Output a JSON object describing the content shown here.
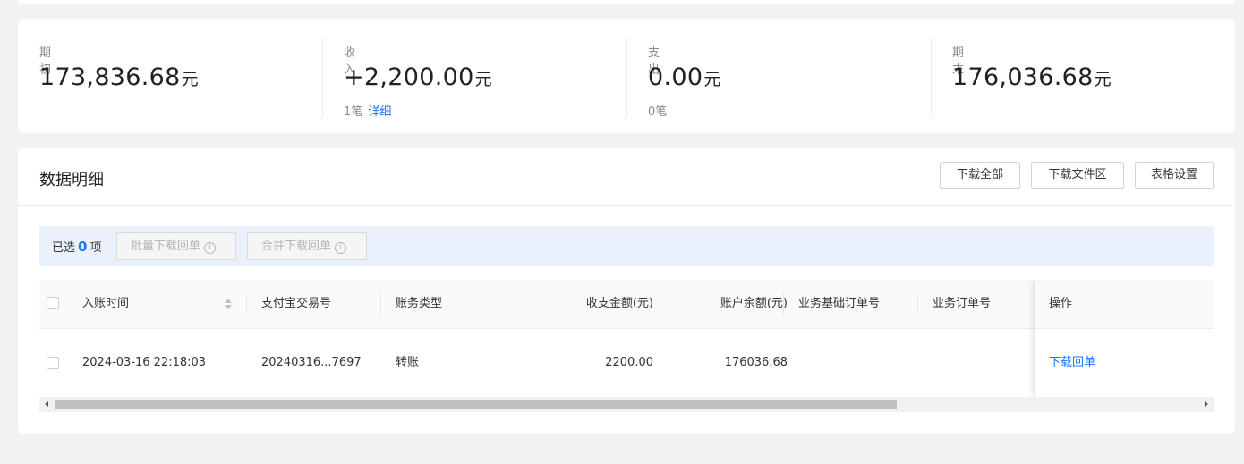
{
  "summary": {
    "opening": {
      "label": "期初",
      "amount": "173,836.68",
      "unit": "元"
    },
    "income": {
      "label": "收入",
      "amount": "+2,200.00",
      "unit": "元",
      "count": "1笔",
      "detail_link": "详细"
    },
    "expense": {
      "label": "支出",
      "amount": "0.00",
      "unit": "元",
      "count": "0笔"
    },
    "closing": {
      "label": "期末",
      "amount": "176,036.68",
      "unit": "元"
    }
  },
  "detail": {
    "title": "数据明细",
    "buttons": {
      "download_all": "下载全部",
      "download_files": "下载文件区",
      "table_settings": "表格设置"
    },
    "selection": {
      "prefix": "已选",
      "count": "0",
      "suffix": "项",
      "batch_download": "批量下载回单",
      "merge_download": "合并下载回单",
      "info_glyph": "i"
    },
    "table": {
      "columns": [
        "入账时间",
        "支付宝交易号",
        "账务类型",
        "收支金额(元)",
        "账户余额(元)",
        "业务基础订单号",
        "业务订单号",
        "操作"
      ],
      "rows": [
        {
          "time": "2024-03-16 22:18:03",
          "trade_no": "20240316...7697",
          "type": "转账",
          "amount": "2200.00",
          "balance": "176036.68",
          "base_order": "",
          "order": "",
          "action": "下载回单"
        }
      ]
    }
  },
  "colors": {
    "accent": "#1677ff",
    "select_bar": "#eaf1fd",
    "page_bg": "#f2f2f2"
  }
}
